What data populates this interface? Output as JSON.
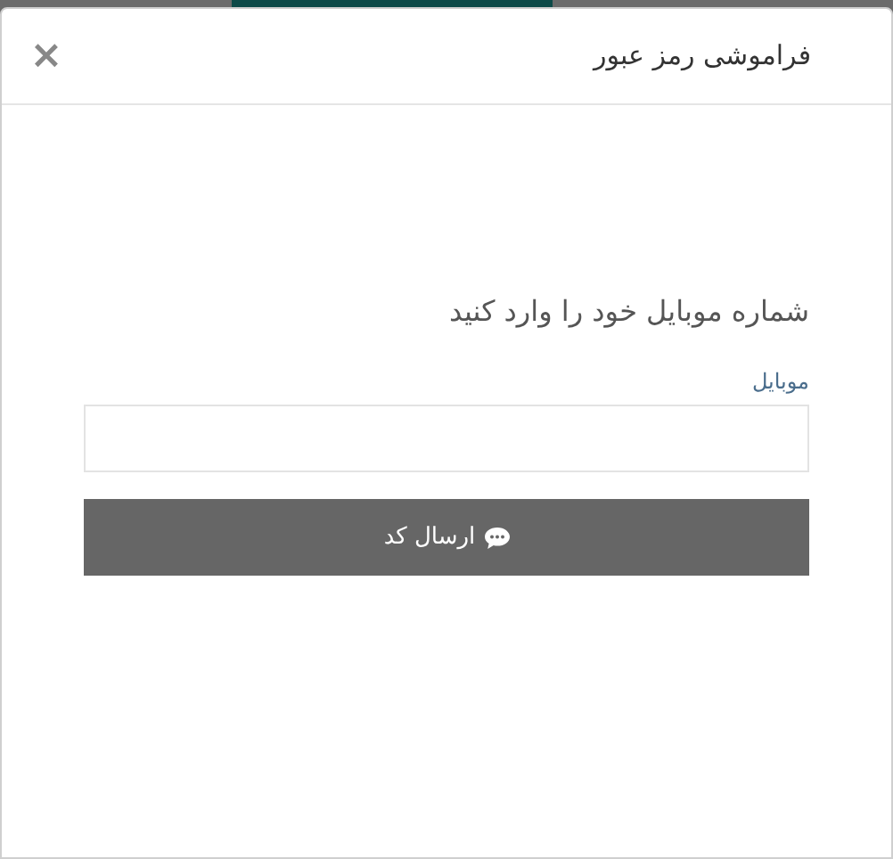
{
  "dialog": {
    "title": "فراموشی رمز عبور",
    "close": "×"
  },
  "prompt": "شماره موبایل خود را وارد کنید",
  "field": {
    "label": "موبایل"
  },
  "submit_button": {
    "label": "ارسال کد"
  }
}
